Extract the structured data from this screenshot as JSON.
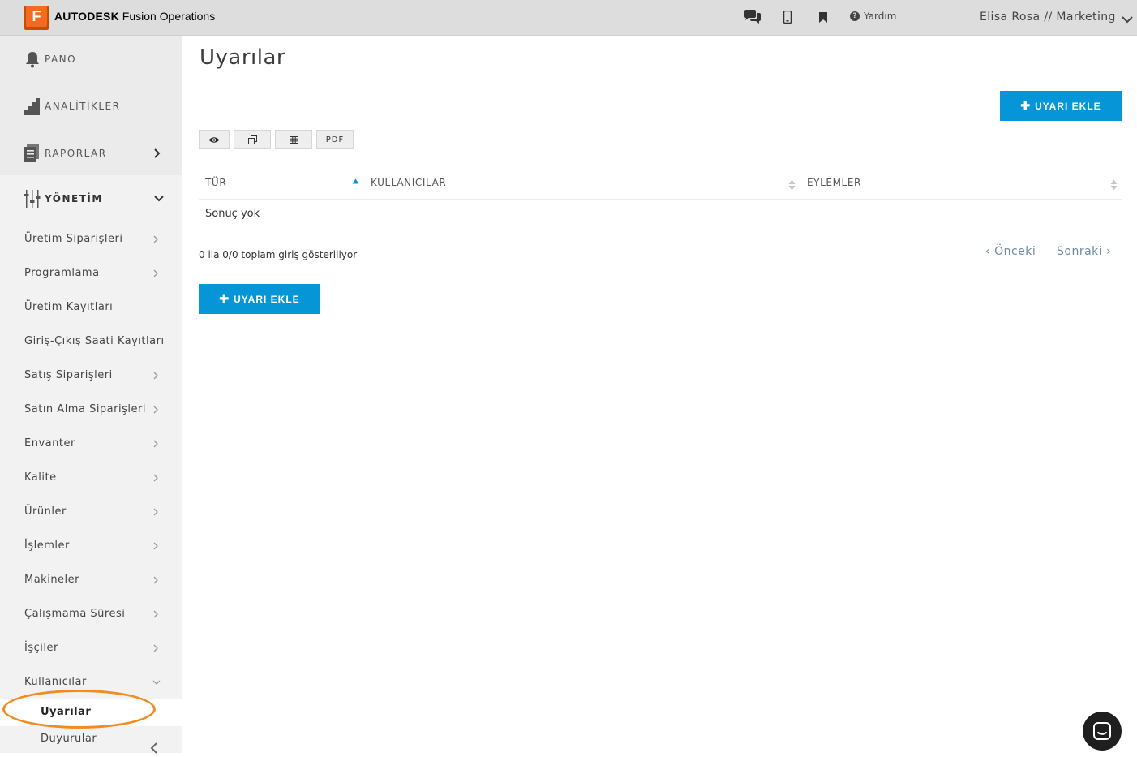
{
  "header": {
    "brand_bold": "AUTODESK",
    "brand_light": "Fusion Operations",
    "logo_letter": "F",
    "help_label": "Yardım",
    "user_label": "Elisa Rosa // Marketing",
    "icons": [
      "chat-icon",
      "mobile-icon",
      "bookmark-icon",
      "help-icon",
      "chevron-down-icon"
    ]
  },
  "sidebar": {
    "main": [
      {
        "label": "PANO",
        "icon": "bell-icon"
      },
      {
        "label": "ANALİTİKLER",
        "icon": "bar-chart-icon"
      },
      {
        "label": "RAPORLAR",
        "icon": "report-icon"
      },
      {
        "label": "YÖNETİM",
        "icon": "sliders-icon"
      }
    ],
    "items": [
      {
        "label": "Üretim Siparişleri",
        "chevron": true
      },
      {
        "label": "Programlama",
        "chevron": true
      },
      {
        "label": "Üretim Kayıtları",
        "chevron": false
      },
      {
        "label": "Giriş-Çıkış Saati Kayıtları",
        "chevron": false
      },
      {
        "label": "Satış Siparişleri",
        "chevron": true
      },
      {
        "label": "Satın Alma Siparişleri",
        "chevron": true
      },
      {
        "label": "Envanter",
        "chevron": true
      },
      {
        "label": "Kalite",
        "chevron": true
      },
      {
        "label": "Ürünler",
        "chevron": true
      },
      {
        "label": "İşlemler",
        "chevron": true
      },
      {
        "label": "Makineler",
        "chevron": true
      },
      {
        "label": "Çalışmama Süresi",
        "chevron": true
      },
      {
        "label": "İşçiler",
        "chevron": true
      },
      {
        "label": "Kullanıcılar",
        "chevron": "down"
      }
    ],
    "sub_items": [
      {
        "label": "Uyarılar",
        "active": true
      },
      {
        "label": "Duyurular",
        "active": false
      }
    ]
  },
  "main": {
    "title": "Uyarılar",
    "add_button_label": "UYARI EKLE",
    "toolbar": [
      "eye-icon",
      "copy-icon",
      "table-icon",
      "PDF"
    ],
    "columns": [
      "TÜR",
      "KULLANICILAR",
      "EYLEMLER"
    ],
    "empty_text": "Sonuç yok",
    "info_text": "0 ila 0/0 toplam giriş gösteriliyor",
    "pager_prev": "Önceki",
    "pager_next": "Sonraki"
  },
  "colors": {
    "accent": "#0696d7",
    "brand_orange": "#f26b21",
    "highlight": "#f28c1f"
  }
}
